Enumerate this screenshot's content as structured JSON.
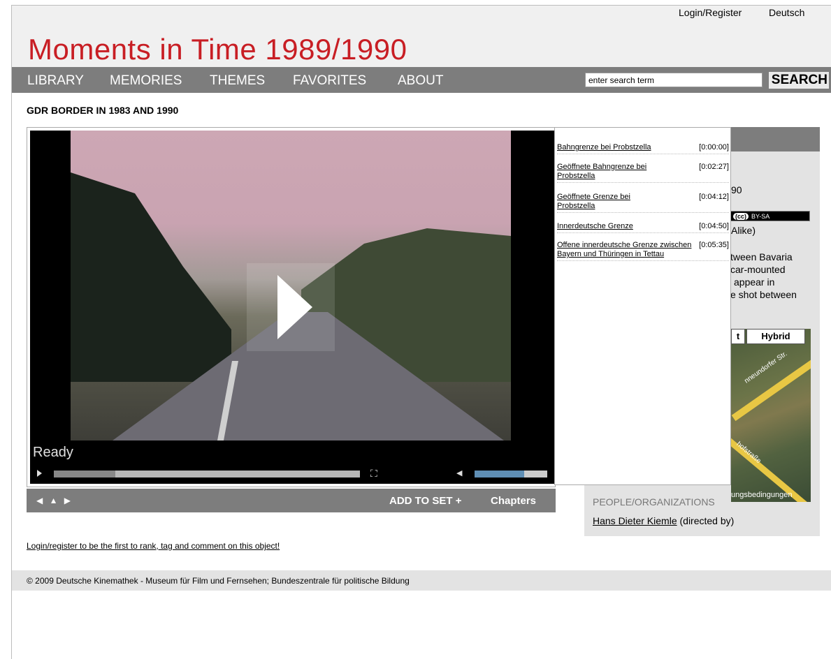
{
  "topbar": {
    "login": "Login/Register",
    "language": "Deutsch"
  },
  "site": {
    "title": "Moments in Time 1989/1990"
  },
  "nav": {
    "items": [
      "LIBRARY",
      "MEMORIES",
      "THEMES",
      "FAVORITES",
      "ABOUT"
    ],
    "search_placeholder": "enter search term",
    "search_value": "enter search term",
    "search_label": "SEARCH"
  },
  "page": {
    "title": "GDR BORDER IN 1983 AND 1990"
  },
  "player": {
    "status": "Ready",
    "progress": 0.2,
    "volume": 0.68,
    "add_to_set": "ADD TO SET +",
    "chapters_label": "Chapters",
    "arrows": "◀ ▲ ▶"
  },
  "chapters": [
    {
      "title": "Bahngrenze bei Probstzella",
      "time": "[0:00:00]"
    },
    {
      "title": "Geöffnete Bahngrenze bei Probstzella",
      "time": "[0:02:27]"
    },
    {
      "title": "Geöffnete Grenze bei Probstzella",
      "time": "[0:04:12]"
    },
    {
      "title": "Innerdeutsche Grenze",
      "time": "[0:04:50]"
    },
    {
      "title": "Offene innerdeutsche Grenze zwischen Bayern und Thüringen in Tettau",
      "time": "[0:05:35]"
    }
  ],
  "sidebar": {
    "year_fragment": "90",
    "license_badge": "BY-SA",
    "license_cc": "(cc)",
    "license_fragment": "Alike)",
    "desc_lines": [
      "tween Bavaria",
      "car-mounted",
      "appear in",
      "e shot between"
    ],
    "map": {
      "btn_prev": "t",
      "btn_hybrid": "Hybrid",
      "street1": "nneundorfer Str.",
      "street2": "hofstraße",
      "terms": "ungsbedingungen"
    },
    "people_heading": "PEOPLE/ORGANIZATIONS",
    "people_name": "Hans Dieter Kiemle",
    "people_role": " (directed by)"
  },
  "login_prompt": "Login/register to be the first to rank, tag and comment on this object!",
  "footer": "© 2009 Deutsche Kinemathek - Museum für Film und Fernsehen; Bundeszentrale für politische Bildung"
}
